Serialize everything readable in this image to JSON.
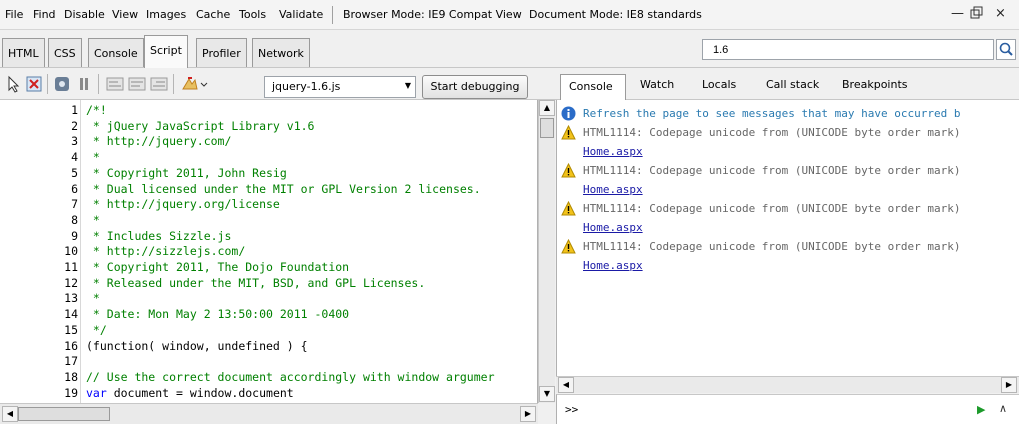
{
  "menu": {
    "items": [
      "File",
      "Find",
      "Disable",
      "View",
      "Images",
      "Cache",
      "Tools",
      "Validate"
    ],
    "browser_mode": "Browser Mode: IE9 Compat View",
    "document_mode": "Document Mode: IE8 standards"
  },
  "tabs": [
    "HTML",
    "CSS",
    "Console",
    "Script",
    "Profiler",
    "Network"
  ],
  "active_tab": "Script",
  "search": {
    "value": "1.6"
  },
  "toolbar": {
    "file_select": "jquery-1.6.js",
    "start_debugging": "Start debugging"
  },
  "right_tabs": [
    "Console",
    "Watch",
    "Locals",
    "Call stack",
    "Breakpoints"
  ],
  "code": {
    "lines": [
      {
        "n": "1",
        "text": "/*!",
        "kind": "cm"
      },
      {
        "n": "2",
        "text": " * jQuery JavaScript Library v1.6",
        "kind": "cm"
      },
      {
        "n": "3",
        "text": " * http://jquery.com/",
        "kind": "cm"
      },
      {
        "n": "4",
        "text": " *",
        "kind": "cm"
      },
      {
        "n": "5",
        "text": " * Copyright 2011, John Resig",
        "kind": "cm"
      },
      {
        "n": "6",
        "text": " * Dual licensed under the MIT or GPL Version 2 licenses.",
        "kind": "cm"
      },
      {
        "n": "7",
        "text": " * http://jquery.org/license",
        "kind": "cm"
      },
      {
        "n": "8",
        "text": " *",
        "kind": "cm"
      },
      {
        "n": "9",
        "text": " * Includes Sizzle.js",
        "kind": "cm"
      },
      {
        "n": "10",
        "text": " * http://sizzlejs.com/",
        "kind": "cm"
      },
      {
        "n": "11",
        "text": " * Copyright 2011, The Dojo Foundation",
        "kind": "cm"
      },
      {
        "n": "12",
        "text": " * Released under the MIT, BSD, and GPL Licenses.",
        "kind": "cm"
      },
      {
        "n": "13",
        "text": " *",
        "kind": "cm"
      },
      {
        "n": "14",
        "text": " * Date: Mon May 2 13:50:00 2011 -0400",
        "kind": "cm"
      },
      {
        "n": "15",
        "text": " */",
        "kind": "cm"
      },
      {
        "n": "16",
        "text": "(function( window, undefined ) {",
        "kind": "pl"
      },
      {
        "n": "17",
        "text": "",
        "kind": "pl"
      },
      {
        "n": "18",
        "text": "// Use the correct document accordingly with window argumer",
        "kind": "cm"
      },
      {
        "n": "19",
        "text_kw": "var",
        "text": " document = window.document",
        "kind": "pl"
      }
    ]
  },
  "console": {
    "info": "Refresh the page to see messages that may have occurred b",
    "warnings": [
      {
        "text": "HTML1114: Codepage unicode from (UNICODE byte order mark)",
        "link": "Home.aspx"
      },
      {
        "text": "HTML1114: Codepage unicode from (UNICODE byte order mark)",
        "link": "Home.aspx"
      },
      {
        "text": "HTML1114: Codepage unicode from (UNICODE byte order mark)",
        "link": "Home.aspx"
      },
      {
        "text": "HTML1114: Codepage unicode from (UNICODE byte order mark)",
        "link": "Home.aspx"
      }
    ],
    "prompt": ">>"
  },
  "icons": {
    "select": "cursor-icon",
    "clear": "clear-icon",
    "breakall": "break-icon",
    "pause": "pause-icon",
    "info": "info-icon",
    "warning": "warning-icon",
    "run": "run-icon",
    "expand": "expand-icon",
    "search": "search-icon"
  }
}
